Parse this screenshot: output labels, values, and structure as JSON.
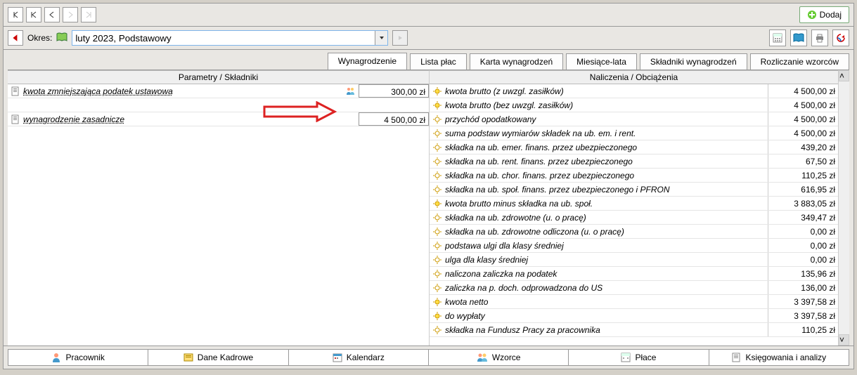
{
  "toolbar": {
    "dodaj": "Dodaj"
  },
  "period": {
    "label": "Okres:",
    "value": "luty 2023, Podstawowy"
  },
  "tabs": {
    "wynagrodzenie": "Wynagrodzenie",
    "lista_plac": "Lista płac",
    "karta": "Karta wynagrodzeń",
    "miesiace": "Miesiące-lata",
    "skladniki": "Składniki wynagrodzeń",
    "rozliczanie": "Rozliczanie wzorców"
  },
  "headers": {
    "left": "Parametry / Składniki",
    "right": "Naliczenia / Obciążenia"
  },
  "left_rows": [
    {
      "label": "kwota zmniejszająca podatek ustawowa",
      "value": "300,00 zł",
      "icon": "doc"
    },
    {
      "label": "wynagrodzenie zasadnicze",
      "value": "4 500,00 zł",
      "icon": "doc-calc"
    }
  ],
  "right_rows": [
    {
      "label": "kwota brutto (z uwzgl. zasiłków)",
      "value": "4 500,00 zł",
      "highlight": true
    },
    {
      "label": "kwota brutto (bez uwzgl. zasiłków)",
      "value": "4 500,00 zł",
      "highlight": true
    },
    {
      "label": "przychód opodatkowany",
      "value": "4 500,00 zł"
    },
    {
      "label": "suma podstaw wymiarów składek na ub. em. i rent.",
      "value": "4 500,00 zł"
    },
    {
      "label": "składka na ub. emer. finans. przez ubezpieczonego",
      "value": "439,20 zł"
    },
    {
      "label": "składka na ub. rent. finans. przez ubezpieczonego",
      "value": "67,50 zł"
    },
    {
      "label": "składka na ub. chor. finans. przez ubezpieczonego",
      "value": "110,25 zł"
    },
    {
      "label": "składka na ub. społ. finans. przez ubezpieczonego i PFRON",
      "value": "616,95 zł"
    },
    {
      "label": "kwota brutto minus składka na ub. społ.",
      "value": "3 883,05 zł",
      "highlight": true
    },
    {
      "label": "składka na ub. zdrowotne (u. o pracę)",
      "value": "349,47 zł"
    },
    {
      "label": "składka na ub. zdrowotne odliczona (u. o pracę)",
      "value": "0,00 zł"
    },
    {
      "label": "podstawa ulgi dla klasy średniej",
      "value": "0,00 zł"
    },
    {
      "label": "ulga dla klasy średniej",
      "value": "0,00 zł"
    },
    {
      "label": "naliczona zaliczka na podatek",
      "value": "135,96 zł"
    },
    {
      "label": "zaliczka na p. doch. odprowadzona do US",
      "value": "136,00 zł"
    },
    {
      "label": "kwota netto",
      "value": "3 397,58 zł",
      "highlight": true
    },
    {
      "label": "do wypłaty",
      "value": "3 397,58 zł",
      "highlight": true
    },
    {
      "label": "składka na Fundusz Pracy za pracownika",
      "value": "110,25 zł"
    }
  ],
  "bottom": {
    "pracownik": "Pracownik",
    "dane": "Dane Kadrowe",
    "kalendarz": "Kalendarz",
    "wzorce": "Wzorce",
    "place": "Płace",
    "ksiegowania": "Księgowania i analizy"
  }
}
